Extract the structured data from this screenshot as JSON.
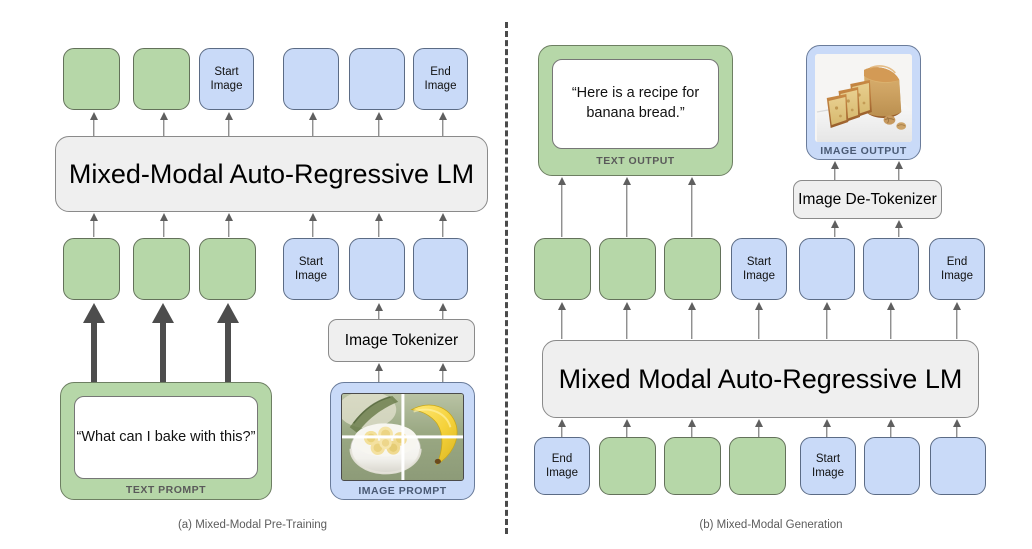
{
  "figure": {
    "panel_a": {
      "caption": "(a) Mixed-Modal Pre-Training",
      "model_label": "Mixed-Modal Auto-Regressive LM",
      "tokenizer_label": "Image Tokenizer",
      "text_prompt": {
        "quote": "“What can I bake with this?”",
        "caption": "TEXT PROMPT"
      },
      "image_prompt": {
        "caption": "IMAGE PROMPT",
        "alt": "bowl of sliced bananas and a whole banana, split into 4 patches"
      },
      "output_tokens": [
        {
          "type": "text",
          "label": ""
        },
        {
          "type": "text",
          "label": ""
        },
        {
          "type": "image",
          "label": "Start Image"
        },
        {
          "type": "image",
          "label": ""
        },
        {
          "type": "image",
          "label": ""
        },
        {
          "type": "image",
          "label": "End Image"
        }
      ],
      "input_tokens": [
        {
          "type": "text",
          "label": ""
        },
        {
          "type": "text",
          "label": ""
        },
        {
          "type": "text",
          "label": ""
        },
        {
          "type": "image",
          "label": "Start Image"
        },
        {
          "type": "image",
          "label": ""
        },
        {
          "type": "image",
          "label": ""
        }
      ]
    },
    "panel_b": {
      "caption": "(b) Mixed-Modal Generation",
      "model_label": "Mixed Modal Auto-Regressive LM",
      "detokenizer_label": "Image De-Tokenizer",
      "text_output": {
        "quote": "“Here is a recipe for banana bread.”",
        "caption": "TEXT OUTPUT"
      },
      "image_output": {
        "caption": "IMAGE OUTPUT",
        "alt": "sliced banana bread loaf on a white board with walnuts"
      },
      "output_tokens": [
        {
          "type": "text",
          "label": ""
        },
        {
          "type": "text",
          "label": ""
        },
        {
          "type": "text",
          "label": ""
        },
        {
          "type": "image",
          "label": "Start Image"
        },
        {
          "type": "image",
          "label": ""
        },
        {
          "type": "image",
          "label": ""
        },
        {
          "type": "image",
          "label": "End Image"
        }
      ],
      "input_tokens": [
        {
          "type": "image",
          "label": "End Image"
        },
        {
          "type": "text",
          "label": ""
        },
        {
          "type": "text",
          "label": ""
        },
        {
          "type": "text",
          "label": ""
        },
        {
          "type": "image",
          "label": "Start Image"
        },
        {
          "type": "image",
          "label": ""
        },
        {
          "type": "image",
          "label": ""
        }
      ]
    },
    "colors": {
      "text_token": "#b6d7a8",
      "image_token": "#c9daf8",
      "block": "#efefef",
      "arrow": "#5f5f5f",
      "divider": "#4a4a4a"
    }
  }
}
